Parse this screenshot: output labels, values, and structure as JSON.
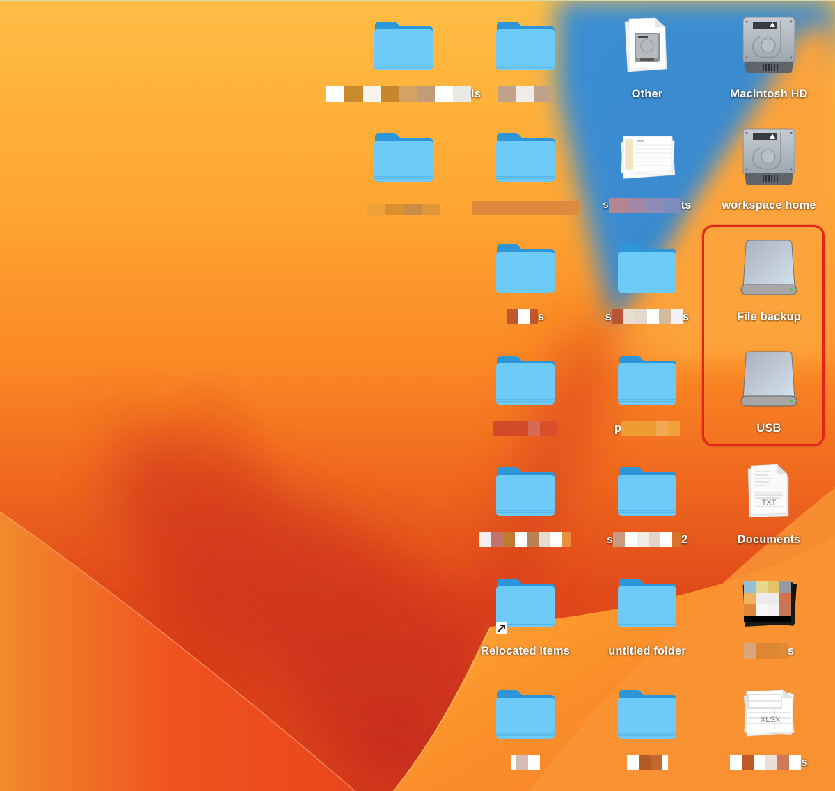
{
  "desktop": {
    "wallpaper": "macOS Ventura orange wallpaper",
    "highlight_color": "#e3231e",
    "folder_color": "#6ecbf7",
    "items": [
      {
        "id": "r1c1",
        "type": "folder",
        "label_visible": "ls",
        "redacted": true
      },
      {
        "id": "r1c2",
        "type": "folder",
        "label_visible": "",
        "redacted": true
      },
      {
        "id": "r1c3",
        "type": "disk-image-document",
        "label": "Other",
        "redacted": false
      },
      {
        "id": "r1c4",
        "type": "internal-hard-drive",
        "label": "Macintosh HD",
        "redacted": false
      },
      {
        "id": "r2c1",
        "type": "folder",
        "label_visible": "",
        "redacted": true
      },
      {
        "id": "r2c2",
        "type": "folder",
        "label_visible": "",
        "redacted": true
      },
      {
        "id": "r2c3",
        "type": "spreadsheet-documents",
        "label_visible": "ts",
        "redacted": true
      },
      {
        "id": "r2c4",
        "type": "internal-hard-drive",
        "label": "workspace home",
        "redacted": false
      },
      {
        "id": "r3c2",
        "type": "folder",
        "label_visible": "s",
        "redacted": true
      },
      {
        "id": "r3c3",
        "type": "folder",
        "label_visible": "s",
        "redacted": true
      },
      {
        "id": "r3c4",
        "type": "external-drive",
        "label": "File backup",
        "redacted": false,
        "highlighted": true
      },
      {
        "id": "r4c2",
        "type": "folder",
        "label_visible": "",
        "redacted": true
      },
      {
        "id": "r4c3",
        "type": "folder",
        "label_visible": "p",
        "redacted": true
      },
      {
        "id": "r4c4",
        "type": "external-drive",
        "label": "USB",
        "redacted": false,
        "highlighted": true
      },
      {
        "id": "r5c2",
        "type": "folder",
        "label_visible": "",
        "redacted": true
      },
      {
        "id": "r5c3",
        "type": "folder",
        "label_visible": "2",
        "redacted": true
      },
      {
        "id": "r5c4",
        "type": "txt-documents",
        "label": "Documents",
        "redacted": false,
        "badge": "TXT"
      },
      {
        "id": "r6c2",
        "type": "folder-alias",
        "label": "Relocated Items",
        "redacted": false
      },
      {
        "id": "r6c3",
        "type": "folder",
        "label": "untitled folder",
        "redacted": false
      },
      {
        "id": "r6c4",
        "type": "image-stack",
        "label_visible": "s",
        "redacted": true
      },
      {
        "id": "r7c2",
        "type": "folder",
        "label_visible": "",
        "redacted": true
      },
      {
        "id": "r7c3",
        "type": "folder",
        "label_visible": "",
        "redacted": true
      },
      {
        "id": "r7c4",
        "type": "xlsx-documents",
        "label_visible": "s",
        "redacted": true,
        "badge": "XLSX"
      }
    ]
  },
  "labels": {
    "other": "Other",
    "macintosh_hd": "Macintosh HD",
    "workspace_home": "workspace home",
    "file_backup": "File backup",
    "usb": "USB",
    "documents": "Documents",
    "relocated_items": "Relocated Items",
    "untitled_folder": "untitled folder",
    "r1c1_suffix": "ls",
    "r2c3_prefix": "S",
    "r2c3_suffix": "ts",
    "r3c2_suffix": "s",
    "r3c3_prefix": "s",
    "r3c3_suffix": "s",
    "r4c3_prefix": "p",
    "r5c3_prefix": "s",
    "r5c3_suffix": "2",
    "r6c4_suffix": "s",
    "r7c4_suffix": "s"
  },
  "badges": {
    "txt": "TXT",
    "xlsx": "XLSX"
  }
}
